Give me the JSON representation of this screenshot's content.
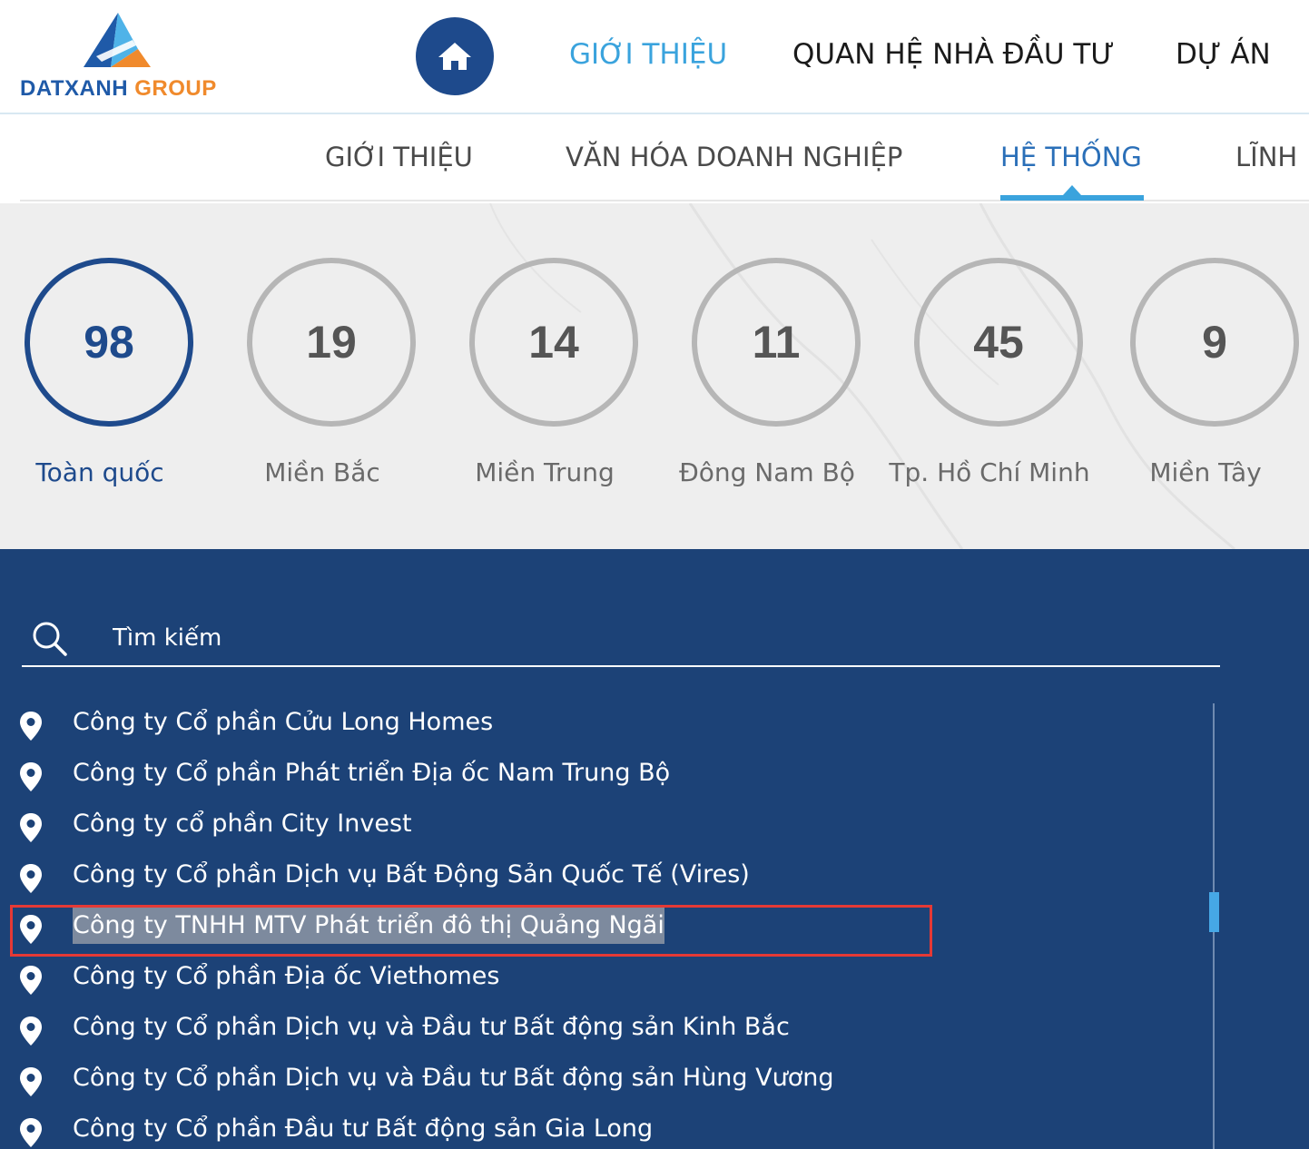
{
  "logo": {
    "text_part1": "DATXANH",
    "text_part2": "GROUP",
    "colors": {
      "blue": "#1f5aa8",
      "orange": "#f08a2c",
      "light_blue": "#4fb3e8"
    }
  },
  "header": {
    "home_icon": "home-icon",
    "nav": [
      {
        "label": "GIỚI THIỆU",
        "active": true
      },
      {
        "label": "QUAN HỆ NHÀ ĐẦU TƯ",
        "active": false
      },
      {
        "label": "DỰ ÁN",
        "active": false
      }
    ]
  },
  "subnav": {
    "items": [
      {
        "label": "GIỚI THIỆU",
        "active": false
      },
      {
        "label": "VĂN HÓA DOANH NGHIỆP",
        "active": false
      },
      {
        "label": "HỆ THỐNG",
        "active": true
      },
      {
        "label": "LĨNH",
        "active": false
      }
    ]
  },
  "stats": [
    {
      "value": "98",
      "label": "Toàn quốc",
      "active": true
    },
    {
      "value": "19",
      "label": "Miền Bắc",
      "active": false
    },
    {
      "value": "14",
      "label": "Miền Trung",
      "active": false
    },
    {
      "value": "11",
      "label": "Đông Nam Bộ",
      "active": false
    },
    {
      "value": "45",
      "label": "Tp. Hồ Chí Minh",
      "active": false
    },
    {
      "value": "9",
      "label": "Miền Tây",
      "active": false
    }
  ],
  "search": {
    "placeholder": "Tìm kiếm",
    "icon": "search-icon"
  },
  "companies": [
    {
      "name": "Công ty Cổ phần Cửu Long Homes",
      "selected": false
    },
    {
      "name": "Công ty Cổ phần Phát triển Địa ốc Nam Trung Bộ",
      "selected": false
    },
    {
      "name": "Công ty cổ phần City Invest",
      "selected": false
    },
    {
      "name": "Công ty Cổ phần Dịch vụ Bất Động Sản Quốc Tế (Vires)",
      "selected": false
    },
    {
      "name": "Công ty TNHH MTV Phát triển đô thị Quảng Ngãi",
      "selected": true
    },
    {
      "name": "Công ty Cổ phần Địa ốc Viethomes",
      "selected": false
    },
    {
      "name": "Công ty Cổ phần Dịch vụ và Đầu tư Bất động sản Kinh Bắc",
      "selected": false
    },
    {
      "name": "Công ty Cổ phần Dịch vụ và Đầu tư Bất động sản Hùng Vương",
      "selected": false
    },
    {
      "name": "Công ty Cổ phần Đầu tư Bất động sản Gia Long",
      "selected": false
    }
  ],
  "colors": {
    "primary_dark": "#1e4a8c",
    "accent": "#3aa3dd",
    "panel_bg": "#1c4277",
    "highlight_border": "#e53935"
  }
}
